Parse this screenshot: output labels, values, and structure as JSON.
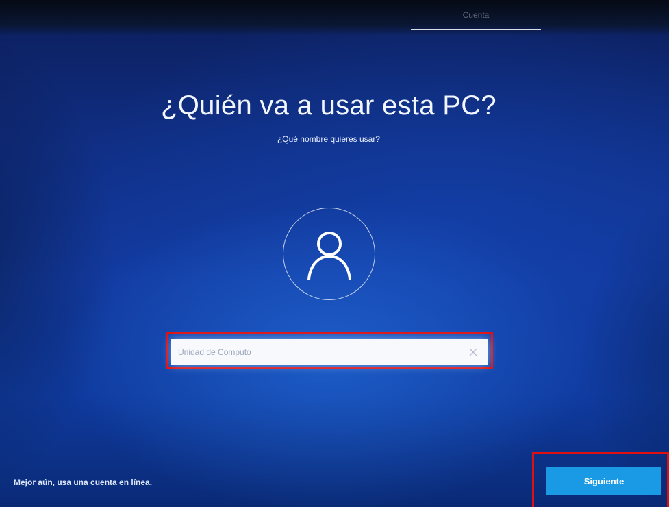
{
  "header": {
    "progress_label": "Cuenta"
  },
  "main": {
    "title": "¿Quién va a usar esta PC?",
    "subtitle": "¿Qué nombre quieres usar?",
    "avatar_icon": "user-icon",
    "name_input": {
      "value": "Unidad de Computo",
      "clear_icon": "close-icon"
    }
  },
  "footer": {
    "online_account_link": "Mejor aún, usa una cuenta en línea.",
    "next_button": "Siguiente"
  },
  "colors": {
    "accent_button": "#1a9ae4",
    "annotation_highlight": "#e01010"
  }
}
